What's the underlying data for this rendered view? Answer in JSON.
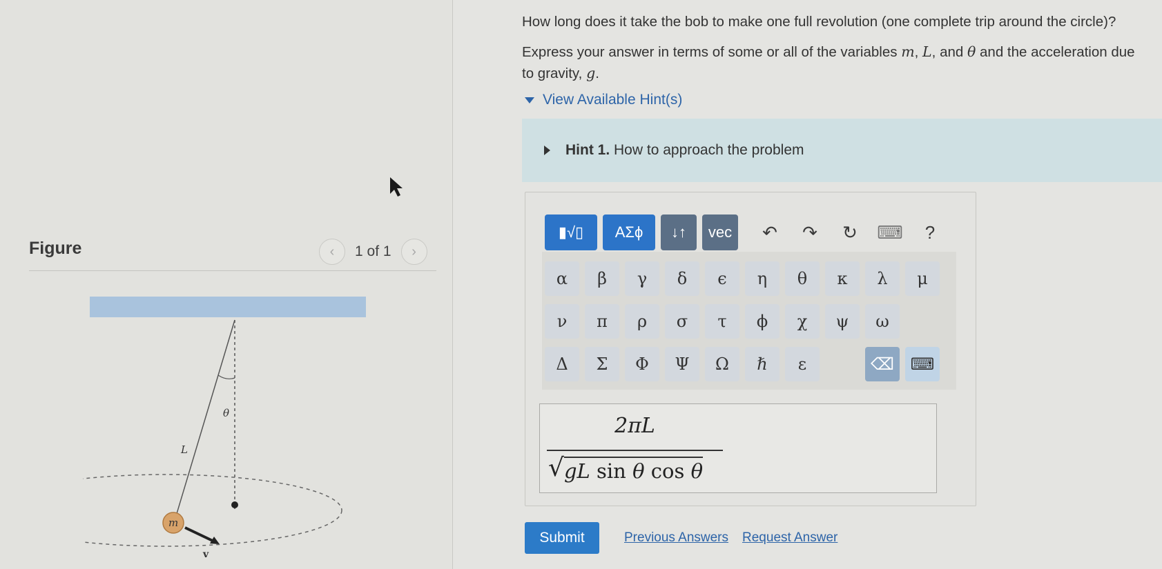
{
  "figure": {
    "title": "Figure",
    "page_indicator": "1 of 1",
    "labels": {
      "theta": "θ",
      "length": "L",
      "mass": "m",
      "velocity": "v"
    }
  },
  "question": {
    "prompt": "How long does it take the bob to make one full revolution (one complete trip around the circle)?",
    "instruction_start": "Express your answer in terms of some or all of the variables",
    "var_m": "m",
    "var_L": "L",
    "var_theta": "θ",
    "and_word": ", and",
    "instruction_end": "and the acceleration due to gravity,",
    "var_g": "g",
    "period": "."
  },
  "hints": {
    "toggle_label": "View Available Hint(s)",
    "hint_number": "Hint 1.",
    "hint_title": "How to approach the problem"
  },
  "toolbar": {
    "templates": "▮√▯",
    "symbols": "ΑΣϕ",
    "ordering": "↓↑",
    "vec": "vec",
    "undo": "↶",
    "redo": "↷",
    "reset": "↻",
    "keyboard": "⌨",
    "help": "?"
  },
  "keyboard": {
    "row1": [
      "α",
      "β",
      "γ",
      "δ",
      "ϵ",
      "η",
      "θ",
      "κ",
      "λ",
      "μ"
    ],
    "row2": [
      "ν",
      "π",
      "ρ",
      "σ",
      "τ",
      "ϕ",
      "χ",
      "ψ",
      "ω"
    ],
    "row3": [
      "Δ",
      "Σ",
      "Φ",
      "Ψ",
      "Ω",
      "ℏ",
      "ε"
    ],
    "backspace": "⌫",
    "keyboard_toggle": "⌨"
  },
  "answer": {
    "numerator": "2πL",
    "sqrt": "√",
    "denominator_g": "gL",
    "sin": "sin",
    "theta1": "θ",
    "cos": "cos",
    "theta2": "θ"
  },
  "actions": {
    "submit": "Submit",
    "previous": "Previous Answers",
    "request": "Request Answer"
  }
}
